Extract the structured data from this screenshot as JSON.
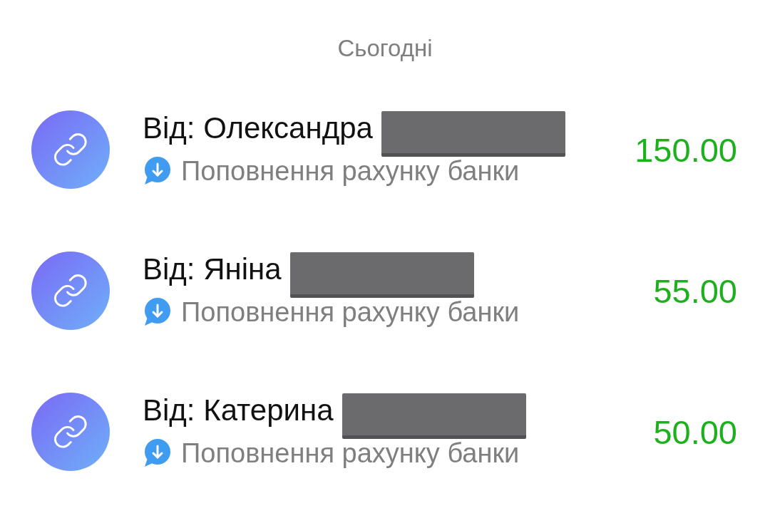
{
  "section_header": "Сьогодні",
  "transactions": [
    {
      "title": "Від: Олександра",
      "redacted": true,
      "description": "Поповнення рахунку банки",
      "amount": "150.00"
    },
    {
      "title": "Від: Яніна",
      "redacted": true,
      "description": "Поповнення рахунку банки",
      "amount": "55.00"
    },
    {
      "title": "Від: Катерина",
      "redacted": true,
      "description": "Поповнення рахунку банки",
      "amount": "50.00"
    }
  ]
}
